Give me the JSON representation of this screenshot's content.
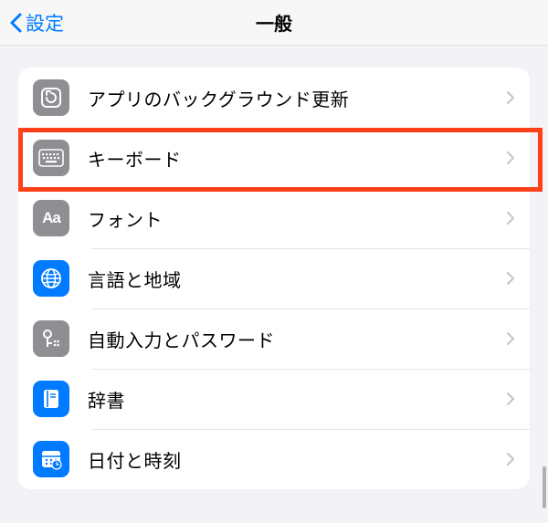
{
  "header": {
    "back_label": "設定",
    "title": "一般"
  },
  "rows": [
    {
      "id": "background-refresh",
      "icon": "refresh-icon",
      "icon_bg": "#8e8e93",
      "label": "アプリのバックグラウンド更新",
      "highlighted": false
    },
    {
      "id": "keyboard",
      "icon": "keyboard-icon",
      "icon_bg": "#8e8e93",
      "label": "キーボード",
      "highlighted": true
    },
    {
      "id": "fonts",
      "icon": "fonts-icon",
      "icon_bg": "#8e8e93",
      "label": "フォント",
      "highlighted": false
    },
    {
      "id": "language-region",
      "icon": "globe-icon",
      "icon_bg": "#007aff",
      "label": "言語と地域",
      "highlighted": false
    },
    {
      "id": "passwords",
      "icon": "key-icon",
      "icon_bg": "#8e8e93",
      "label": "自動入力とパスワード",
      "highlighted": false
    },
    {
      "id": "dictionary",
      "icon": "book-icon",
      "icon_bg": "#007aff",
      "label": "辞書",
      "highlighted": false
    },
    {
      "id": "date-time",
      "icon": "calendar-icon",
      "icon_bg": "#007aff",
      "label": "日付と時刻",
      "highlighted": false
    }
  ],
  "colors": {
    "accent": "#007aff",
    "highlight": "#ff4019"
  }
}
